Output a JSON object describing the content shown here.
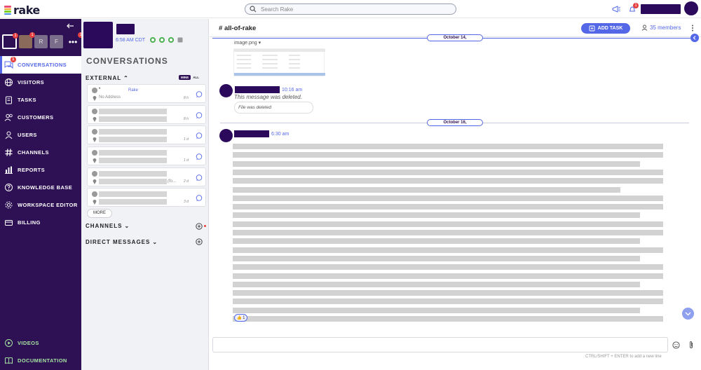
{
  "app": {
    "name": "rake"
  },
  "colors": {
    "brand": "#2e1054",
    "accent": "#5468e7",
    "badge": "#e53e3e",
    "nav_bottom": "#a6e3a1"
  },
  "search": {
    "placeholder": "Search Rake"
  },
  "topbar": {
    "notification_count": "1"
  },
  "workspaces": {
    "items": [
      {
        "label": "",
        "badge": "1",
        "active": true
      },
      {
        "label": "",
        "badge": "1",
        "active": false
      },
      {
        "label": "R",
        "badge": "",
        "active": false
      },
      {
        "label": "F",
        "badge": "",
        "active": false
      }
    ],
    "more_label": "•••",
    "more_badge": "1"
  },
  "nav": {
    "items": [
      {
        "label": "CONVERSATIONS",
        "icon": "chat-icon",
        "badge": "1",
        "active": true
      },
      {
        "label": "VISITORS",
        "icon": "globe-icon"
      },
      {
        "label": "TASKS",
        "icon": "clipboard-icon"
      },
      {
        "label": "CUSTOMERS",
        "icon": "customers-icon"
      },
      {
        "label": "USERS",
        "icon": "user-icon"
      },
      {
        "label": "CHANNELS",
        "icon": "hash-icon"
      },
      {
        "label": "REPORTS",
        "icon": "bar-chart-icon"
      },
      {
        "label": "KNOWLEDGE BASE",
        "icon": "help-icon"
      },
      {
        "label": "WORKSPACE EDITOR",
        "icon": "gear-icon"
      },
      {
        "label": "BILLING",
        "icon": "wallet-icon"
      }
    ],
    "bottom": [
      {
        "label": "VIDEOS",
        "icon": "play-icon"
      },
      {
        "label": "DOCUMENTATION",
        "icon": "book-icon"
      }
    ]
  },
  "conversations": {
    "header_time": "6:58 AM CDT",
    "title": "CONVERSATIONS",
    "external_label": "EXTERNAL",
    "toggle_mine": "MINE",
    "toggle_all": "ALL",
    "items": [
      {
        "name": "•",
        "agent": "Rake",
        "address": "No Address",
        "extra": "",
        "time": "8 h"
      },
      {
        "name": "",
        "agent": "",
        "address": "",
        "extra": "",
        "time": "8 h"
      },
      {
        "name": "",
        "agent": "",
        "address": "",
        "extra": "",
        "time": "1 d"
      },
      {
        "name": "",
        "agent": "",
        "address": "",
        "extra": "",
        "time": "1 d"
      },
      {
        "name": "",
        "agent": "",
        "address": "",
        "extra": "(fo...",
        "time": "2 d"
      },
      {
        "name": "",
        "agent": "",
        "address": "",
        "extra": "",
        "time": "3 d"
      }
    ],
    "more_label": "MORE",
    "channels_label": "CHANNELS",
    "dm_label": "DIRECT MESSAGES"
  },
  "channel": {
    "name": "all-of-rake",
    "add_task_label": "ADD TASK",
    "members_label": "35 members",
    "date1": "October 14,",
    "date2": "October 16,",
    "image_caption": "image.png ▾",
    "msg1_time": "10:16 am",
    "msg1_deleted": "This message was deleted.",
    "msg1_file": "File was deleted",
    "msg2_time": "6:30 am",
    "reaction_emoji": "👍",
    "reaction_count": "1"
  },
  "composer": {
    "placeholder": "",
    "hint": "CTRL/SHIFT + ENTER to add a new line"
  }
}
